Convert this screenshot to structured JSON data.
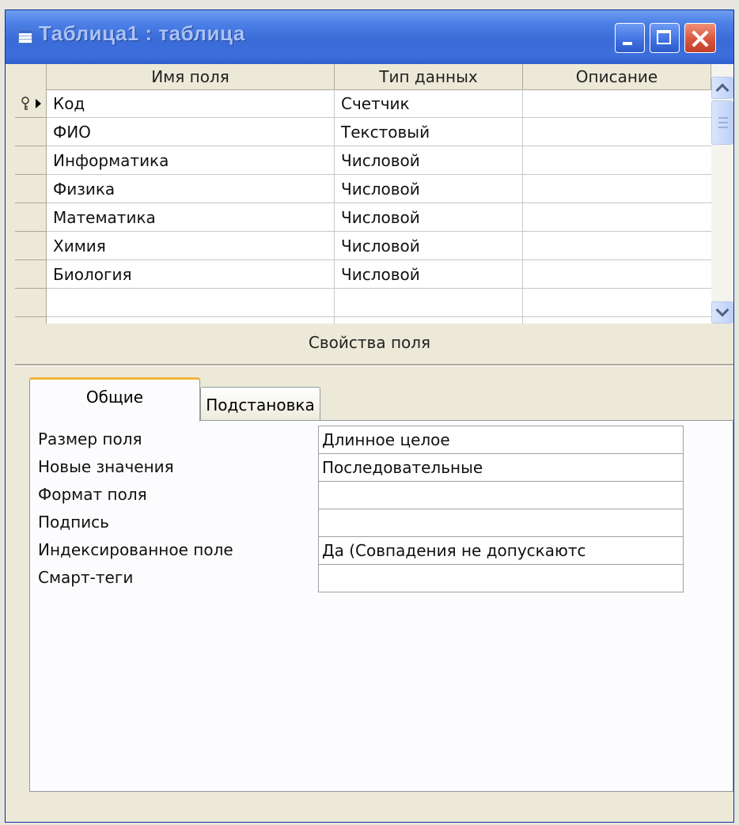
{
  "window": {
    "title": "Таблица1 : таблица"
  },
  "grid": {
    "columns": [
      "Имя поля",
      "Тип данных",
      "Описание"
    ],
    "rows": [
      {
        "name": "Код",
        "type": "Счетчик",
        "description": "",
        "primary_key": true,
        "current": true
      },
      {
        "name": "ФИО",
        "type": "Текстовый",
        "description": ""
      },
      {
        "name": "Информатика",
        "type": "Числовой",
        "description": ""
      },
      {
        "name": "Физика",
        "type": "Числовой",
        "description": ""
      },
      {
        "name": "Математика",
        "type": "Числовой",
        "description": ""
      },
      {
        "name": "Химия",
        "type": "Числовой",
        "description": ""
      },
      {
        "name": "Биология",
        "type": "Числовой",
        "description": ""
      },
      {
        "name": "",
        "type": "",
        "description": ""
      },
      {
        "name": "",
        "type": "",
        "description": ""
      }
    ]
  },
  "properties": {
    "caption": "Свойства поля",
    "tabs": [
      "Общие",
      "Подстановка"
    ],
    "active_tab": "Общие",
    "items": [
      {
        "label": "Размер поля",
        "value": "Длинное целое"
      },
      {
        "label": "Новые значения",
        "value": "Последовательные"
      },
      {
        "label": "Формат поля",
        "value": ""
      },
      {
        "label": "Подпись",
        "value": ""
      },
      {
        "label": "Индексированное поле",
        "value": "Да (Совпадения не допускаютс"
      },
      {
        "label": "Смарт-теги",
        "value": ""
      }
    ]
  },
  "colors": {
    "titlebar": "#3a6bd8",
    "title_text": "#a9c2f5",
    "close_button": "#d9553a",
    "window_face": "#ece9d8",
    "active_tab_accent": "#f4b43c"
  }
}
